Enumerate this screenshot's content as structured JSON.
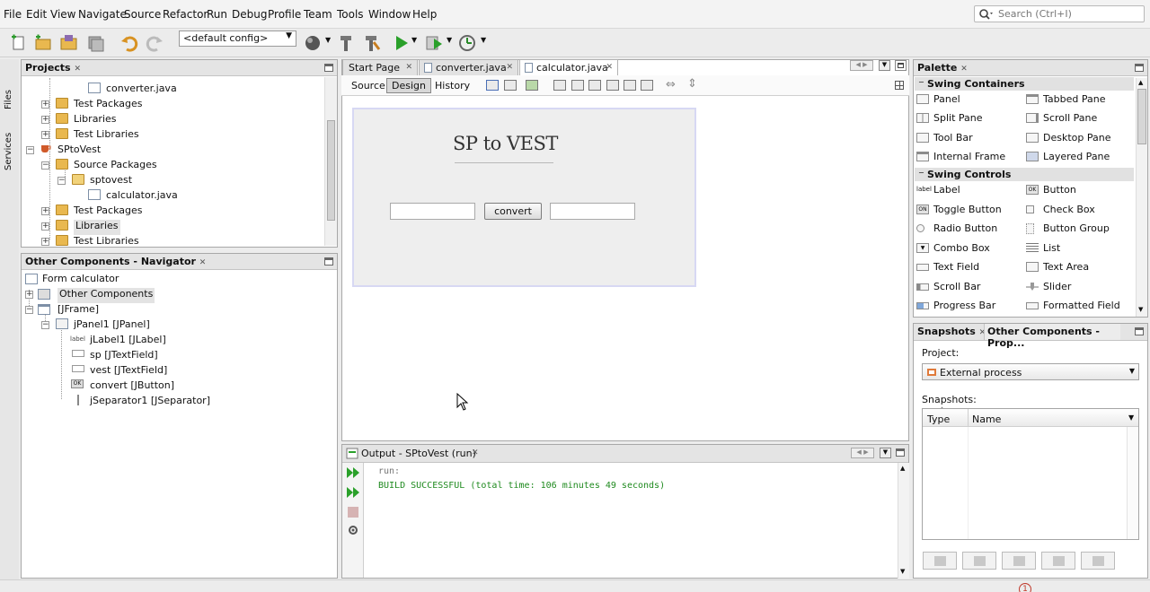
{
  "menu": [
    "File",
    "Edit",
    "View",
    "Navigate",
    "Source",
    "Refactor",
    "Run",
    "Debug",
    "Profile",
    "Team",
    "Tools",
    "Window",
    "Help"
  ],
  "search": {
    "placeholder": "Search (Ctrl+I)"
  },
  "toolbar": {
    "config": "<default config>"
  },
  "side_tabs": {
    "files": "Files",
    "services": "Services"
  },
  "projects": {
    "title": "Projects",
    "rows": [
      "converter.java",
      "Test Packages",
      "Libraries",
      "Test Libraries",
      "SPtoVest",
      "Source Packages",
      "sptovest",
      "calculator.java",
      "Test Packages",
      "Libraries",
      "Test Libraries"
    ]
  },
  "navigator": {
    "title": "Other Components - Navigator",
    "rows": [
      "Form calculator",
      "Other Components",
      "[JFrame]",
      "jPanel1 [JPanel]",
      "jLabel1 [JLabel]",
      "sp [JTextField]",
      "vest [JTextField]",
      "convert [JButton]",
      "jSeparator1 [JSeparator]"
    ],
    "icon_labels": {
      "label": "label",
      "ok": "OK"
    }
  },
  "editor": {
    "tabs": [
      "Start Page",
      "converter.java",
      "calculator.java"
    ],
    "modes": [
      "Source",
      "Design",
      "History"
    ],
    "form": {
      "title": "SP to VEST",
      "button": "convert"
    }
  },
  "palette": {
    "title": "Palette",
    "categories": [
      "Swing Containers",
      "Swing Controls"
    ],
    "containers": [
      "Panel",
      "Tabbed Pane",
      "Split Pane",
      "Scroll Pane",
      "Tool Bar",
      "Desktop Pane",
      "Internal Frame",
      "Layered Pane"
    ],
    "controls": [
      "Label",
      "Button",
      "Toggle Button",
      "Check Box",
      "Radio Button",
      "Button Group",
      "Combo Box",
      "List",
      "Text Field",
      "Text Area",
      "Scroll Bar",
      "Slider",
      "Progress Bar",
      "Formatted Field"
    ],
    "icon_labels": {
      "label": "label",
      "ok": "OK",
      "on": "ON"
    }
  },
  "snapshots": {
    "tabs": [
      "Snapshots",
      "Other Components - Prop..."
    ],
    "project_label": "Project:",
    "project_value": "External process",
    "snapshots_label": "Snapshots:",
    "columns": [
      "Type",
      "Name"
    ]
  },
  "output": {
    "title": "Output - SPtoVest (run)",
    "lines": [
      "run:",
      "BUILD SUCCESSFUL (total time: 106 minutes 49 seconds)"
    ]
  },
  "status": {
    "notification": "1"
  },
  "colors": {
    "build_success": "#1f8a1f",
    "run_green": "#2aa02a"
  }
}
